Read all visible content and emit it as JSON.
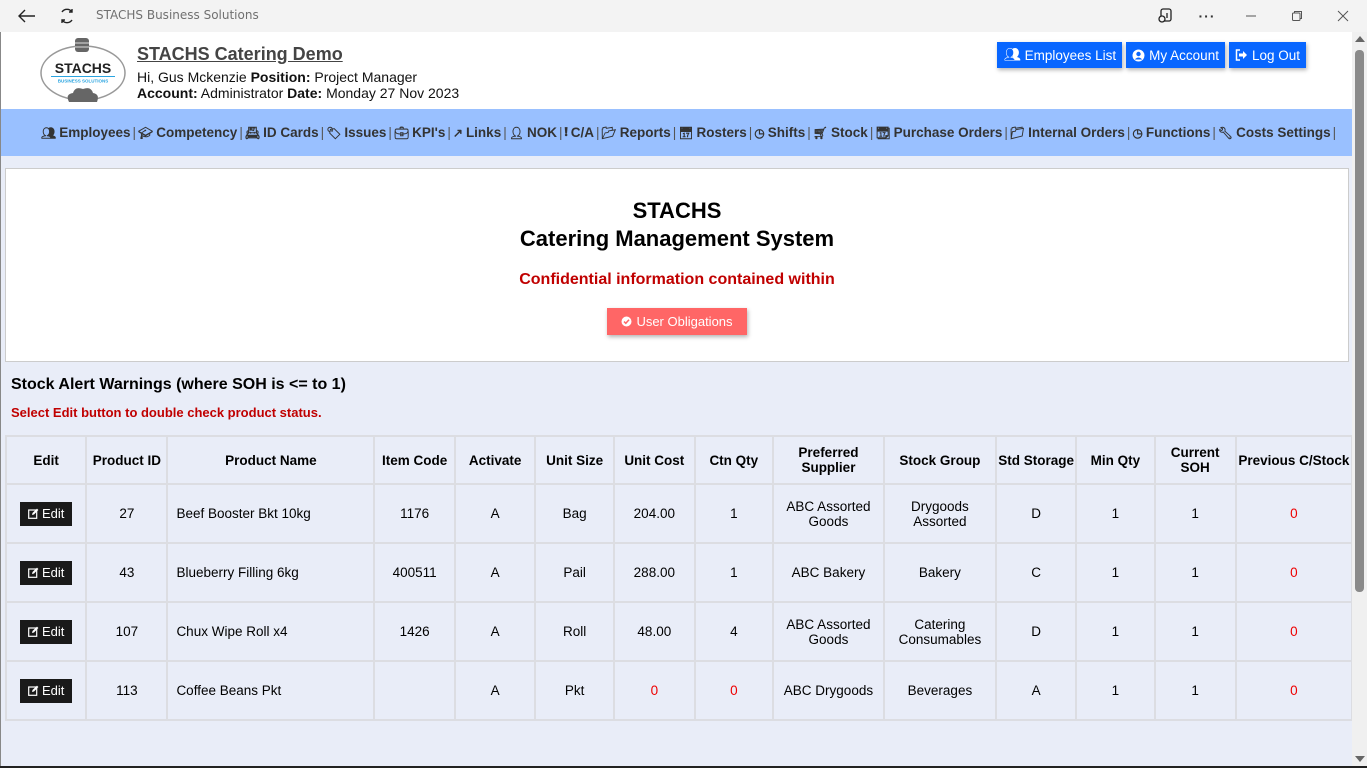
{
  "browser": {
    "title": "STACHS Business Solutions",
    "icons": {
      "back": "arrow-left-icon",
      "reload": "reload-icon",
      "reader": "immersive-reader-icon",
      "more": "more-icon",
      "minimize": "minimize-icon",
      "restore": "restore-icon",
      "close": "close-icon"
    }
  },
  "header": {
    "logo_text": "STACHS",
    "logo_subtext": "BUSINESS SOLUTIONS",
    "site_title": "STACHS Catering Demo",
    "greeting": "Hi, Gus Mckenzie",
    "position_label": "Position:",
    "position_value": "Project Manager",
    "account_label": "Account:",
    "account_value": "Administrator",
    "date_label": "Date:",
    "date_value": "Monday 27 Nov 2023",
    "buttons": [
      {
        "label": "Employees List",
        "icon": "users-icon"
      },
      {
        "label": "My Account",
        "icon": "user-circle-icon"
      },
      {
        "label": "Log Out",
        "icon": "sign-out-icon"
      }
    ],
    "brand_color": "#0866ff"
  },
  "menu": {
    "background": "#99c0ff",
    "items": [
      {
        "label": "Employees",
        "icon": "users-icon"
      },
      {
        "label": "Competency",
        "icon": "graduation-cap-icon"
      },
      {
        "label": "ID Cards",
        "icon": "id-card-icon"
      },
      {
        "label": "Issues",
        "icon": "tags-icon"
      },
      {
        "label": "KPI's",
        "icon": "briefcase-icon"
      },
      {
        "label": "Links",
        "icon": "external-link-icon"
      },
      {
        "label": "NOK",
        "icon": "user-icon"
      },
      {
        "label": "C/A",
        "icon": "exclamation-circle-icon"
      },
      {
        "label": "Reports",
        "icon": "folder-open-icon"
      },
      {
        "label": "Rosters",
        "icon": "calendar-icon"
      },
      {
        "label": "Shifts",
        "icon": "clock-icon"
      },
      {
        "label": "Stock",
        "icon": "shopping-cart-icon"
      },
      {
        "label": "Purchase Orders",
        "icon": "calendar-plus-icon"
      },
      {
        "label": "Internal Orders",
        "icon": "folder-icon"
      },
      {
        "label": "Functions",
        "icon": "clock-icon"
      },
      {
        "label": "Costs Settings",
        "icon": "wrench-icon"
      }
    ]
  },
  "banner": {
    "title_line1": "STACHS",
    "title_line2": "Catering Management System",
    "confidential": "Confidential information contained within",
    "obligations_button": "User Obligations",
    "obligations_color": "#ff6666"
  },
  "alerts": {
    "title": "Stock Alert Warnings (where SOH is <= to 1)",
    "subtitle": "Select Edit button to double check product status.",
    "columns": [
      "Edit",
      "Product ID",
      "Product Name",
      "Item Code",
      "Activate",
      "Unit Size",
      "Unit Cost",
      "Ctn Qty",
      "Preferred Supplier",
      "Stock Group",
      "Std Storage",
      "Min Qty",
      "Current SOH",
      "Previous C/Stock"
    ],
    "edit_label": "Edit",
    "rows": [
      {
        "id": "27",
        "name": "Beef Booster Bkt 10kg",
        "code": "1176",
        "activate": "A",
        "unit_size": "Bag",
        "unit_cost": "204.00",
        "ctn_qty": "1",
        "supplier": "ABC Assorted Goods",
        "group": "Drygoods Assorted",
        "storage": "D",
        "min_qty": "1",
        "soh": "1",
        "prev": "0"
      },
      {
        "id": "43",
        "name": "Blueberry Filling 6kg",
        "code": "400511",
        "activate": "A",
        "unit_size": "Pail",
        "unit_cost": "288.00",
        "ctn_qty": "1",
        "supplier": "ABC Bakery",
        "group": "Bakery",
        "storage": "C",
        "min_qty": "1",
        "soh": "1",
        "prev": "0"
      },
      {
        "id": "107",
        "name": "Chux Wipe Roll x4",
        "code": "1426",
        "activate": "A",
        "unit_size": "Roll",
        "unit_cost": "48.00",
        "ctn_qty": "4",
        "supplier": "ABC Assorted Goods",
        "group": "Catering Consumables",
        "storage": "D",
        "min_qty": "1",
        "soh": "1",
        "prev": "0"
      },
      {
        "id": "113",
        "name": "Coffee Beans Pkt",
        "code": "",
        "activate": "A",
        "unit_size": "Pkt",
        "unit_cost": "0",
        "ctn_qty": "0",
        "supplier": "ABC Drygoods",
        "group": "Beverages",
        "storage": "A",
        "min_qty": "1",
        "soh": "1",
        "prev": "0"
      }
    ],
    "warning_color": "#ee0000"
  }
}
